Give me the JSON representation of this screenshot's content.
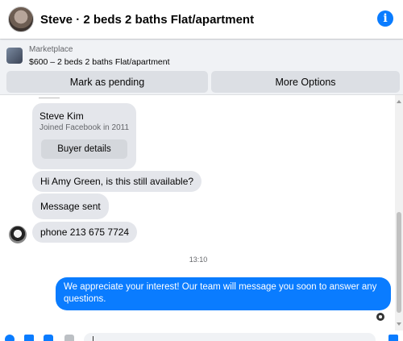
{
  "header": {
    "title": "Steve · 2 beds 2 baths Flat/apartment",
    "info_icon": "info-icon"
  },
  "marketplace": {
    "label": "Marketplace",
    "listing": "$600 – 2 beds 2 baths Flat/apartment",
    "mark_pending": "Mark as pending",
    "more_options": "More Options"
  },
  "profile_card": {
    "name": "Steve Kim",
    "joined": "Joined Facebook in 2011",
    "buyer_details": "Buyer details"
  },
  "messages": {
    "m1": "Hi Amy Green, is this still available?",
    "m2": "Message sent",
    "m3": "phone 213 675 7724",
    "time": "13:10",
    "outgoing": "We appreciate your interest! Our team will message you soon to answer any questions."
  },
  "colors": {
    "accent": "#0a7cff",
    "bubble": "#e4e6eb",
    "bar": "#f0f2f5"
  }
}
